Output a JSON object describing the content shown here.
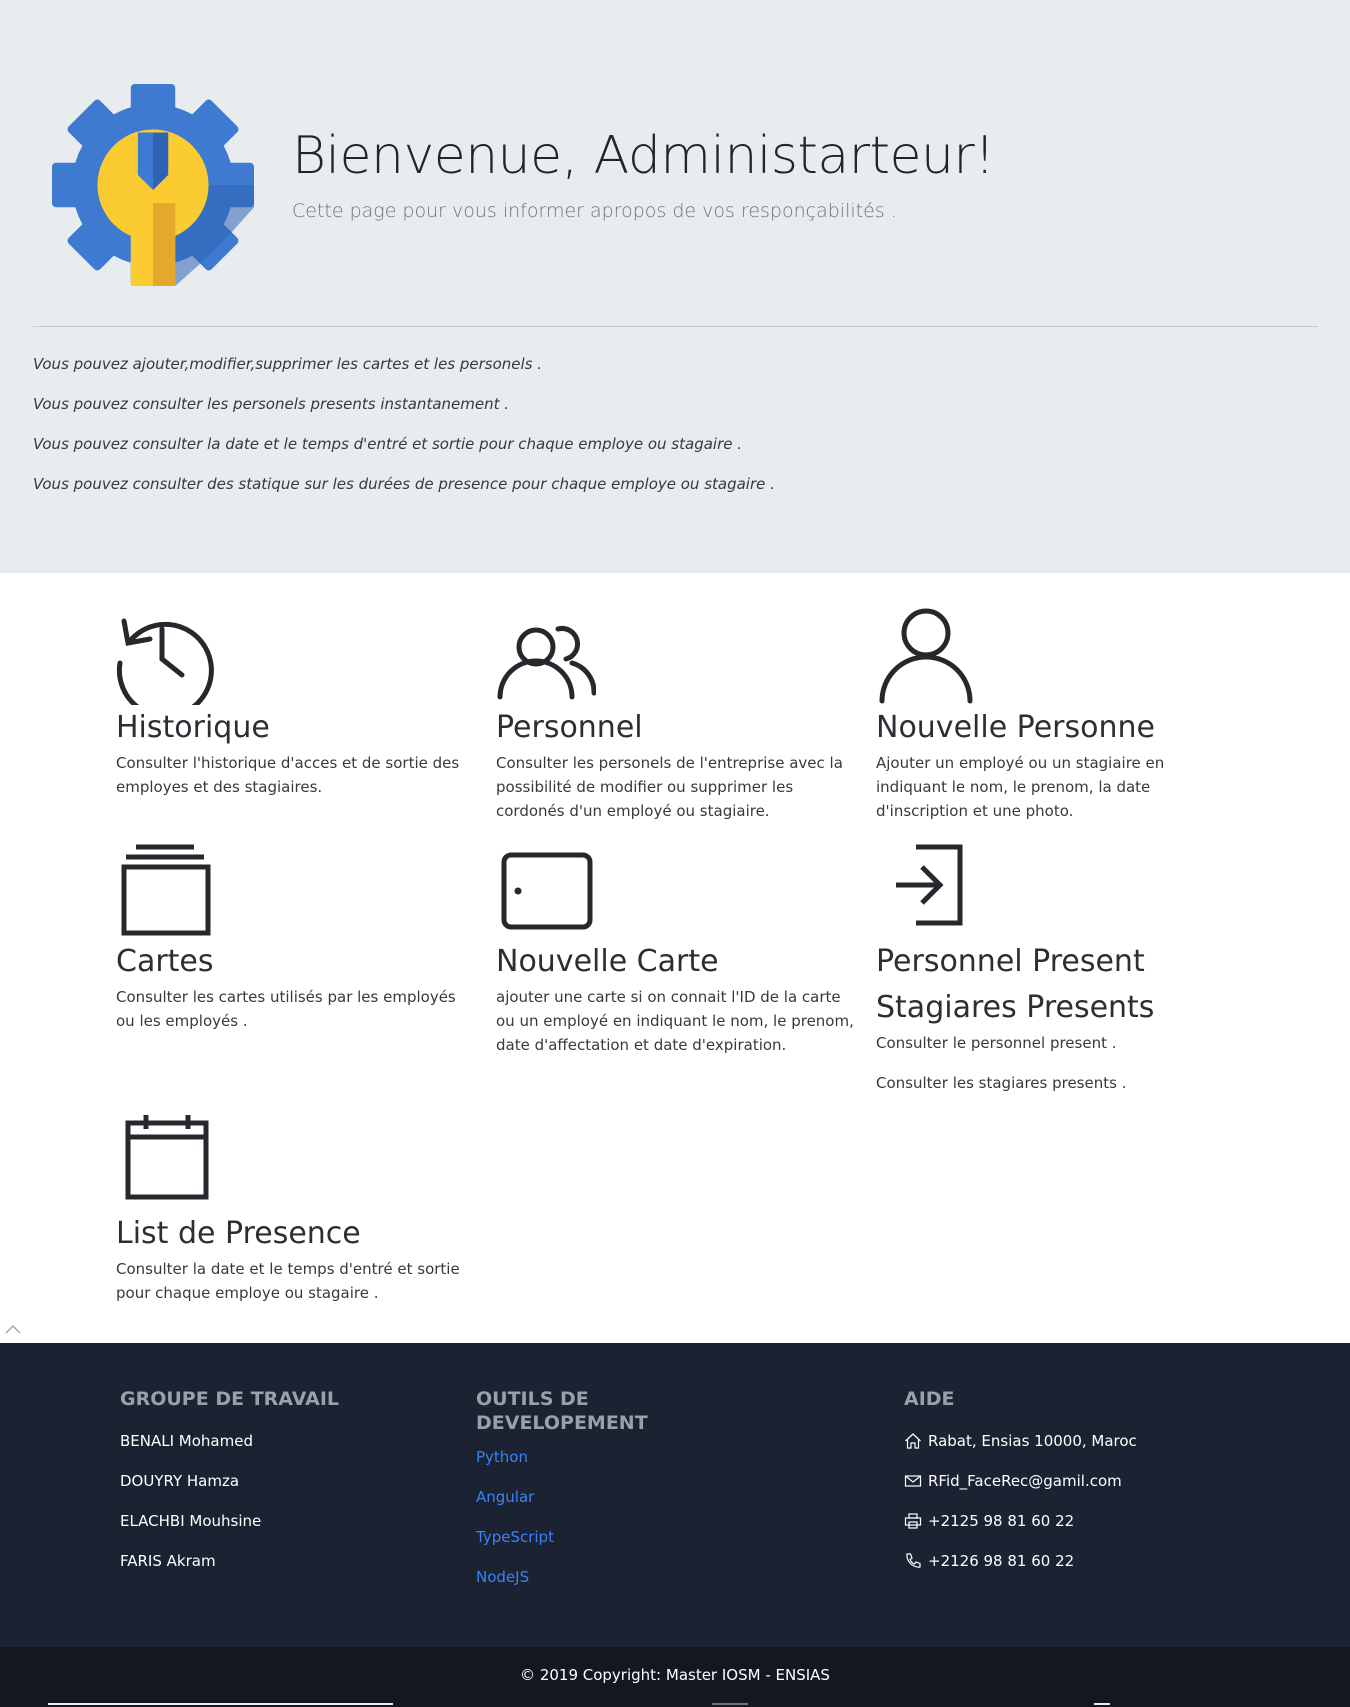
{
  "hero": {
    "title": "Bienvenue, Administarteur!",
    "subtitle": "Cette page pour vous informer apropos de vos responçabilités .",
    "logo_icon": "admin-gear-wrench-icon",
    "colors": {
      "gear": "#3d7ad0",
      "wrench": "#fbcb32",
      "background": "#e9ecef"
    },
    "notes": [
      "Vous pouvez ajouter,modifier,supprimer les cartes et les personels .",
      "Vous pouvez consulter les personels presents instantanement .",
      "Vous pouvez consulter la date et le temps d'entré et sortie pour chaque employe ou stagaire .",
      "Vous pouvez consulter des statique sur les durées de presence pour chaque employe ou stagaire ."
    ]
  },
  "features": {
    "historique": {
      "icon": "history-clock-icon",
      "title": "Historique",
      "text": "Consulter l'historique d'acces et de sortie des employes et des stagiaires."
    },
    "personnel": {
      "icon": "users-icon",
      "title": "Personnel",
      "text": "Consulter les personels de l'entreprise avec la possibilité de modifier ou supprimer les cordonés d'un employé ou stagiaire."
    },
    "nouvelle_personne": {
      "icon": "user-icon",
      "title": "Nouvelle Personne",
      "text": "Ajouter un employé ou un stagiaire en indiquant le nom, le prenom, la date d'inscription et une photo."
    },
    "cartes": {
      "icon": "cards-stack-icon",
      "title": "Cartes",
      "text": "Consulter les cartes utilisés par les employés ou les employés ."
    },
    "nouvelle_carte": {
      "icon": "card-icon",
      "title": "Nouvelle Carte",
      "text": "ajouter une carte si on connait l'ID de la carte ou un employé en indiquant le nom, le prenom, date d'affectation et date d'expiration."
    },
    "present": {
      "icon": "sign-in-icon",
      "title_1": "Personnel Present",
      "title_2": "Stagiares Presents",
      "text_1": "Consulter le personnel present .",
      "text_2": "Consulter les stagiares presents ."
    },
    "list_presence": {
      "icon": "calendar-icon",
      "title": "List de Presence",
      "text": "Consulter la date et le temps d'entré et sortie pour chaque employe ou stagaire ."
    }
  },
  "footer": {
    "group_title": "GROUPE DE TRAVAIL",
    "members": [
      "BENALI Mohamed",
      "DOUYRY Hamza",
      "ELACHBI Mouhsine",
      "FARIS Akram"
    ],
    "tools_title": "OUTILS DE DEVELOPEMENT",
    "tools": [
      "Python",
      "Angular",
      "TypeScript",
      "NodeJS"
    ],
    "aide_title": "AIDE",
    "aide": {
      "address": "Rabat, Ensias 10000, Maroc",
      "email": "RFid_FaceRec@gamil.com",
      "fax": "+2125 98 81 60 22",
      "phone": "+2126 98 81 60 22"
    },
    "copyright": "© 2019 Copyright: Master IOSM - ENSIAS",
    "colors": {
      "footer_bg": "#1b2231",
      "copyright_bg": "#121720",
      "link": "#3b82f6"
    }
  }
}
